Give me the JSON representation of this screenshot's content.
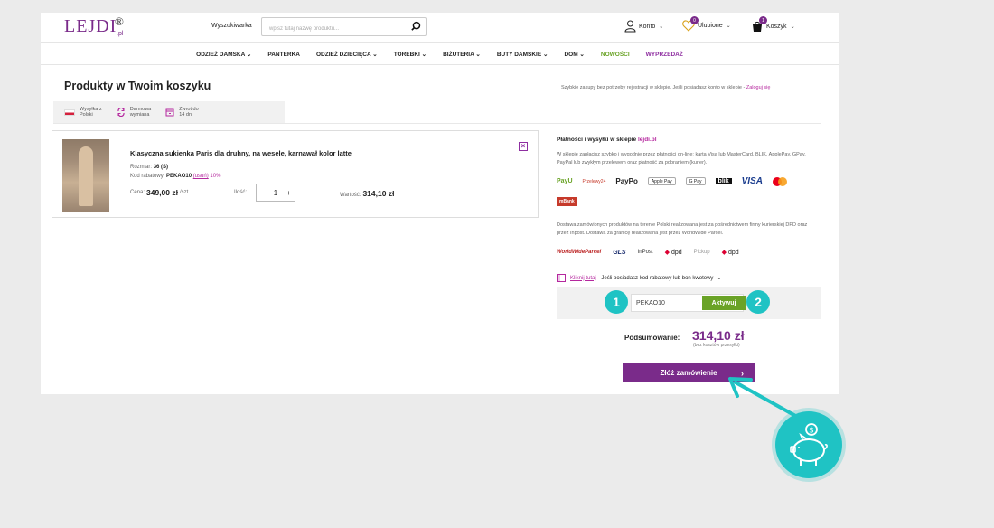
{
  "header": {
    "logo_text": "LEJDI",
    "logo_reg": "®",
    "logo_suffix": ".pl",
    "search_label": "Wyszukiwarka",
    "search_placeholder": "wpisz tutaj nazwę produktu...",
    "account_label": "Konto",
    "favorites_label": "Ulubione",
    "favorites_count": "0",
    "cart_label": "Koszyk",
    "cart_count": "1"
  },
  "nav": [
    {
      "label": "ODZIEŻ DAMSKA",
      "dropdown": true
    },
    {
      "label": "PANTERKA",
      "dropdown": false
    },
    {
      "label": "ODZIEŻ DZIECIĘCA",
      "dropdown": true
    },
    {
      "label": "TOREBKI",
      "dropdown": true
    },
    {
      "label": "BIŻUTERIA",
      "dropdown": true
    },
    {
      "label": "BUTY DAMSKIE",
      "dropdown": true
    },
    {
      "label": "DOM",
      "dropdown": true
    },
    {
      "label": "NOWOŚCI",
      "dropdown": false,
      "color": "#6aa327"
    },
    {
      "label": "WYPRZEDAŻ",
      "dropdown": false,
      "color": "#8e2ea0"
    }
  ],
  "page": {
    "title": "Produkty w Twoim koszyku",
    "quick_note": "Szybkie zakupy bez potrzeby rejestracji w sklepie. Jeśli posiadasz konto w sklepie - ",
    "quick_note_link": "Zaloguj się",
    "perks": [
      {
        "icon": "poland-flag-icon",
        "line1": "Wysyłka z",
        "line2": "Polski"
      },
      {
        "icon": "exchange-icon",
        "line1": "Darmowa",
        "line2": "wymiana"
      },
      {
        "icon": "return-box-icon",
        "line1": "Zwrot do",
        "line2": "14 dni"
      }
    ]
  },
  "cart_item": {
    "name": "Klasyczna sukienka Paris dla druhny, na wesele, karnawał kolor latte",
    "size_label": "Rozmiar:",
    "size_value": "36 (S)",
    "code_label": "Kod rabatowy:",
    "code_value": "PEKAO10",
    "code_link": "(usuń)",
    "code_discount": "10%",
    "price_label": "Cena:",
    "price_value": "349,00 zł",
    "price_unit": "/szt.",
    "qty_label": "Ilość:",
    "qty_value": "1",
    "value_label": "Wartość:",
    "value_amount": "314,10 zł"
  },
  "right_panel": {
    "payments_title": "Płatności i wysyłki w sklepie ",
    "payments_site": "lejdi.pl",
    "payments_text": "W sklepie zapłacisz szybko i wygodnie przez płatności on-line: kartą Visa lub MasterCard, BLIK, ApplePay, GPay, PayPal lub zwykłym przelewem oraz płatność za pobraniem (kurier).",
    "payment_logos": [
      "PayU",
      "Przelewy24",
      "PayPo",
      "Apple Pay",
      "G Pay",
      "blik",
      "VISA",
      "mastercard",
      "mBank"
    ],
    "shipping_text": "Dostawa zamówionych produktów na terenie Polski realizowana jest za pośrednictwem firmy kurierskiej DPD oraz przez Inpost. Dostawa za granicę realizowana jest przez WorldWide Parcel.",
    "shipping_logos": [
      "WorldWideParcel",
      "GLS",
      "InPost",
      "dpd",
      "Pickup",
      "dpd"
    ],
    "discount_link": "Kliknij tutaj",
    "discount_text": " - Jeśli posiadasz kod rabatowy lub bon kwotowy",
    "coupon_value": "PEKAO10",
    "activate_label": "Aktywuj",
    "summary_label": "Podsumowanie:",
    "summary_value": "314,10 zł",
    "summary_note": "(bez kosztów przesyłki)",
    "order_button": "Złóż zamówienie",
    "order_arrow": "›"
  },
  "annotations": {
    "step1": "1",
    "step2": "2",
    "accent": "#1fc3c4"
  },
  "colors": {
    "brand": "#7a2b8a",
    "link": "#b5289e",
    "green": "#6aa327"
  }
}
